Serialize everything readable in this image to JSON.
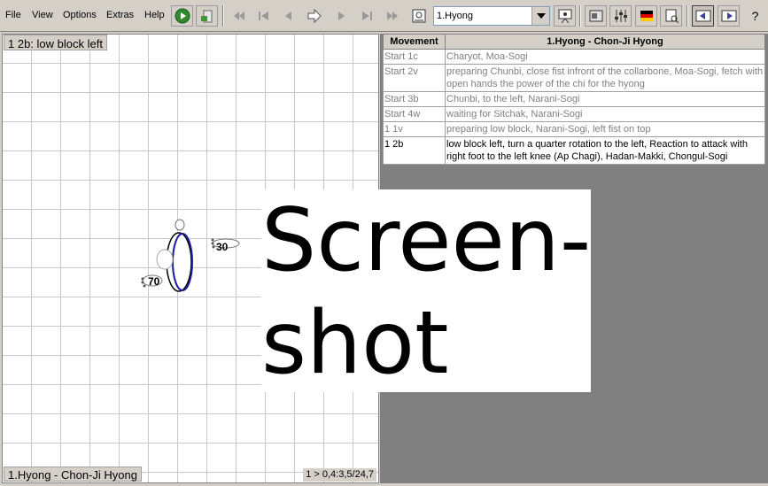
{
  "menu": {
    "file": "File",
    "view": "View",
    "options": "Options",
    "extras": "Extras",
    "help": "Help"
  },
  "toolbar": {
    "combo_value": "1.Hyong",
    "help_label": "?"
  },
  "canvas": {
    "title": "1 2b: low block left",
    "footer": "1.Hyong - Chon-Ji Hyong",
    "status": "1 > 0,4:3,5/24,7",
    "angle_right": "30",
    "angle_left": "70"
  },
  "table": {
    "headers": [
      "Movement",
      "1.Hyong - Chon-Ji Hyong"
    ],
    "rows": [
      {
        "movement": "Start 1c",
        "description": "Charyot, Moa-Sogi"
      },
      {
        "movement": "Start 2v",
        "description": "preparing Chunbi, close fist infront of the collarbone, Moa-Sogi, fetch with open hands the power of the chi for the hyong"
      },
      {
        "movement": "Start 3b",
        "description": "Chunbi, to the left, Narani-Sogi"
      },
      {
        "movement": "Start 4w",
        "description": "waiting for Sitchak, Narani-Sogi"
      },
      {
        "movement": "1 1v",
        "description": "preparing low block, Narani-Sogi, left fist on top"
      },
      {
        "movement": "1 2b",
        "description": "low block left, turn a quarter rotation to the left, Reaction to attack with right foot to the left knee (Ap Chagi), Hadan-Makki, Chongul-Sogi"
      }
    ]
  },
  "overlay": {
    "text": "Screen-\nshot"
  }
}
